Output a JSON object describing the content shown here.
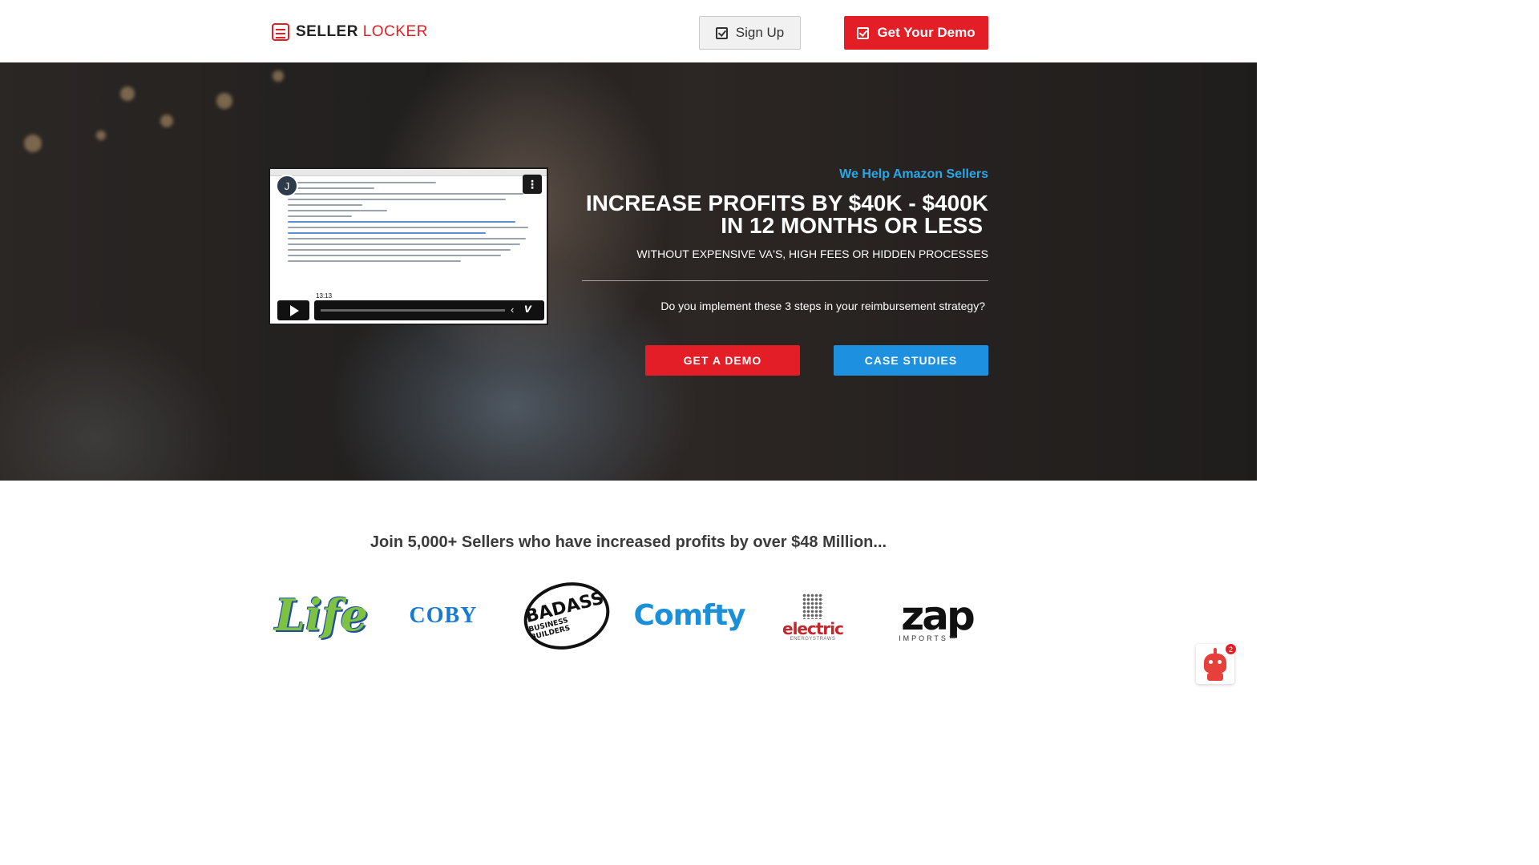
{
  "header": {
    "logo_primary": "SELLER",
    "logo_secondary": "LOCKER",
    "signup_label": "Sign Up",
    "demo_label": "Get Your Demo"
  },
  "hero": {
    "tagline": "We Help Amazon Sellers",
    "headline_line1": "INCREASE PROFITS BY $40K - $400K",
    "headline_line2": "IN 12 MONTHS OR LESS",
    "subhead": "WITHOUT EXPENSIVE VA'S, HIGH FEES OR HIDDEN PROCESSES",
    "question": "Do you implement these 3 steps in your reimbursement strategy?",
    "cta_demo": "GET A DEMO",
    "cta_cases": "CASE STUDIES",
    "video": {
      "avatar_letter": "J",
      "menu_icon": "⋮",
      "duration": "13:13",
      "player_brand": "v"
    }
  },
  "proof": {
    "title": "Join 5,000+ Sellers who have increased profits by over $48 Million...",
    "brands": {
      "life": "Life",
      "coby": "COBY",
      "badass_main": "BADASS",
      "badass_sub": "BUSINESS BUILDERS",
      "comfty": "Comfty",
      "electric": "electric",
      "electric_sub": "ENERGYSTRAWS",
      "zap": "zap",
      "zap_sub": "IMPORTS™"
    }
  },
  "chat": {
    "badge_count": "2"
  },
  "colors": {
    "brand_red": "#e31e26",
    "brand_blue": "#1e90e0",
    "tagline_blue": "#29a8e8"
  }
}
